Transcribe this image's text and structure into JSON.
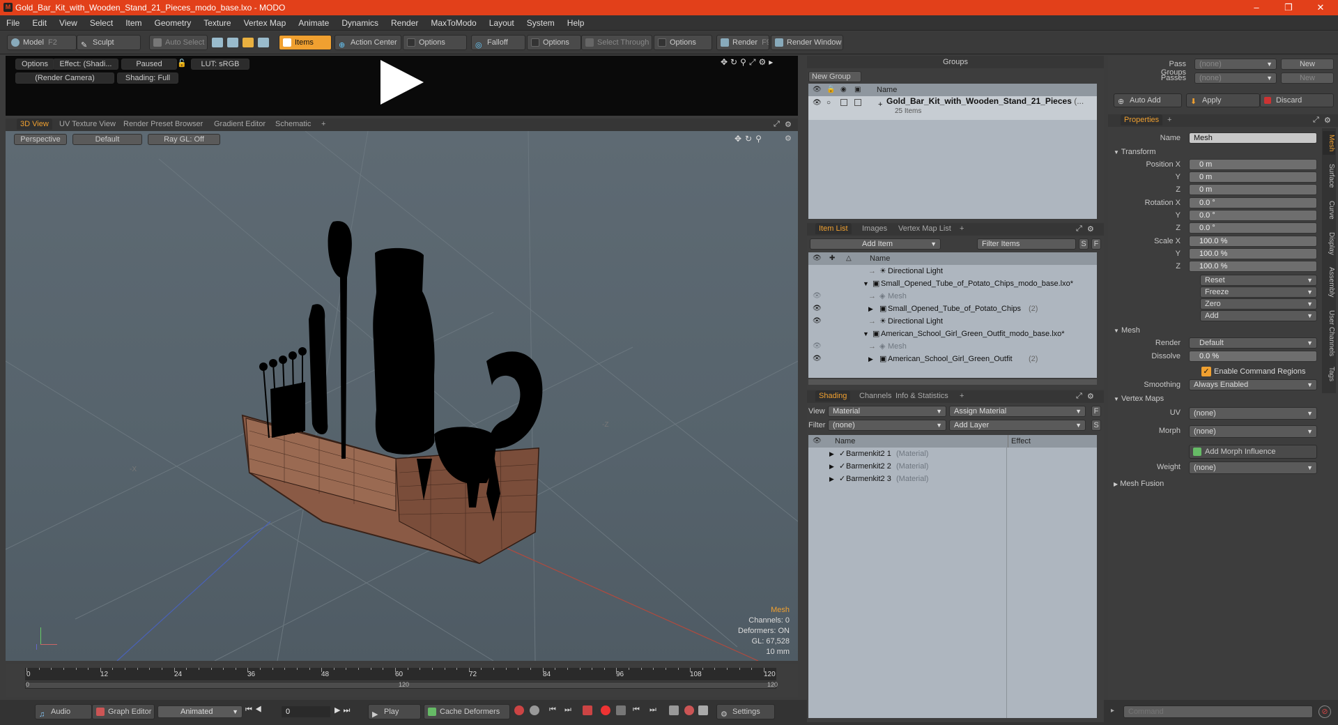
{
  "window": {
    "title": "Gold_Bar_Kit_with_Wooden_Stand_21_Pieces_modo_base.lxo - MODO",
    "app_icon": "M"
  },
  "menu": [
    "File",
    "Edit",
    "View",
    "Select",
    "Item",
    "Geometry",
    "Texture",
    "Vertex Map",
    "Animate",
    "Dynamics",
    "Render",
    "MaxToModo",
    "Layout",
    "System",
    "Help"
  ],
  "toolbar": {
    "model": "Model",
    "model_key": "F2",
    "sculpt": "Sculpt",
    "auto_select": "Auto Select",
    "items": "Items",
    "action_center": "Action Center",
    "options1": "Options",
    "falloff": "Falloff",
    "options2": "Options",
    "select_through": "Select Through",
    "options3": "Options",
    "render": "Render",
    "render_key": "F9",
    "render_window": "Render Window"
  },
  "preview": {
    "options": "Options",
    "effect": "Effect: (Shadi...",
    "paused": "Paused",
    "lut": "LUT: sRGB",
    "camera": "(Render Camera)",
    "shading": "Shading: Full"
  },
  "viewport_tabs": [
    "3D View",
    "UV Texture View",
    "Render Preset Browser",
    "Gradient Editor",
    "Schematic"
  ],
  "viewport": {
    "perspective": "Perspective",
    "default": "Default",
    "raygl": "Ray GL: Off",
    "axis_neg_x": "-X",
    "axis_neg_z": "-Z",
    "info_title": "Mesh",
    "info_channels": "Channels: 0",
    "info_deformers": "Deformers: ON",
    "info_gl": "GL: 67,528",
    "info_scale": "10 mm"
  },
  "timeline": {
    "ticks": [
      "0",
      "12",
      "24",
      "36",
      "48",
      "60",
      "72",
      "84",
      "96",
      "108",
      "120"
    ],
    "sub_ticks": [
      "0",
      "120",
      "120"
    ]
  },
  "bottombar": {
    "audio": "Audio",
    "graph_editor": "Graph Editor",
    "animated": "Animated",
    "frame": "0",
    "play": "Play",
    "cache_deformers": "Cache Deformers",
    "settings": "Settings"
  },
  "groups": {
    "title": "Groups",
    "new_group": "New Group",
    "col_name": "Name",
    "item_name": "Gold_Bar_Kit_with_Wooden_Stand_21_Pieces",
    "item_suffix": "(...",
    "item_count": "25 Items"
  },
  "item_list": {
    "tabs": [
      "Item List",
      "Images",
      "Vertex Map List"
    ],
    "add_item": "Add Item",
    "filter_items": "Filter Items",
    "btn_s": "S",
    "btn_f": "F",
    "col_name": "Name",
    "rows": [
      {
        "label": "Directional Light",
        "extra": ""
      },
      {
        "label": "Small_Opened_Tube_of_Potato_Chips_modo_base.lxo*",
        "extra": ""
      },
      {
        "label": "Mesh",
        "extra": ""
      },
      {
        "label": "Small_Opened_Tube_of_Potato_Chips",
        "extra": "(2)"
      },
      {
        "label": "Directional Light",
        "extra": ""
      },
      {
        "label": "American_School_Girl_Green_Outfit_modo_base.lxo*",
        "extra": ""
      },
      {
        "label": "Mesh",
        "extra": ""
      },
      {
        "label": "American_School_Girl_Green_Outfit",
        "extra": "(2)"
      }
    ]
  },
  "shading": {
    "tabs": [
      "Shading",
      "Channels",
      "Info & Statistics"
    ],
    "view_label": "View",
    "view_value": "Material",
    "assign_material": "Assign Material",
    "filter_label": "Filter",
    "filter_value": "(none)",
    "add_layer": "Add Layer",
    "btn_f": "F",
    "btn_s": "S",
    "col_name": "Name",
    "col_effect": "Effect",
    "rows": [
      {
        "label": "Barmenkit2 1",
        "type": "(Material)"
      },
      {
        "label": "Barmenkit2 2",
        "type": "(Material)"
      },
      {
        "label": "Barmenkit2 3",
        "type": "(Material)"
      }
    ]
  },
  "passes": {
    "pass_groups": "Pass Groups",
    "passes": "Passes",
    "none": "(none)",
    "new": "New",
    "auto_add": "Auto Add",
    "apply": "Apply",
    "discard": "Discard"
  },
  "properties": {
    "tab": "Properties",
    "name_label": "Name",
    "name_value": "Mesh",
    "transform": "Transform",
    "position_label": "Position X",
    "rotation_label": "Rotation X",
    "scale_label": "Scale X",
    "y": "Y",
    "z": "Z",
    "position": [
      "0 m",
      "0 m",
      "0 m"
    ],
    "rotation": [
      "0.0 °",
      "0.0 °",
      "0.0 °"
    ],
    "scale": [
      "100.0 %",
      "100.0 %",
      "100.0 %"
    ],
    "reset": "Reset",
    "freeze": "Freeze",
    "zero": "Zero",
    "add": "Add",
    "mesh": "Mesh",
    "render_label": "Render",
    "render_value": "Default",
    "dissolve_label": "Dissolve",
    "dissolve_value": "0.0 %",
    "enable_cmd": "Enable Command Regions",
    "smoothing_label": "Smoothing",
    "smoothing_value": "Always Enabled",
    "vertex_maps": "Vertex Maps",
    "uv_label": "UV",
    "uv_value": "(none)",
    "morph_label": "Morph",
    "morph_value": "(none)",
    "add_morph": "Add Morph Influence",
    "weight_label": "Weight",
    "weight_value": "(none)",
    "mesh_fusion": "Mesh Fusion"
  },
  "side_tabs": [
    "Mesh",
    "Surface",
    "Curve",
    "Display",
    "Assembly",
    "User Channels",
    "Tags"
  ],
  "command": {
    "placeholder": "Command"
  },
  "colors": {
    "title_bar": "#e2401a",
    "accent": "#f0a030",
    "list_bg": "#aeb6bf",
    "viewport_bg": "#5b6770"
  }
}
